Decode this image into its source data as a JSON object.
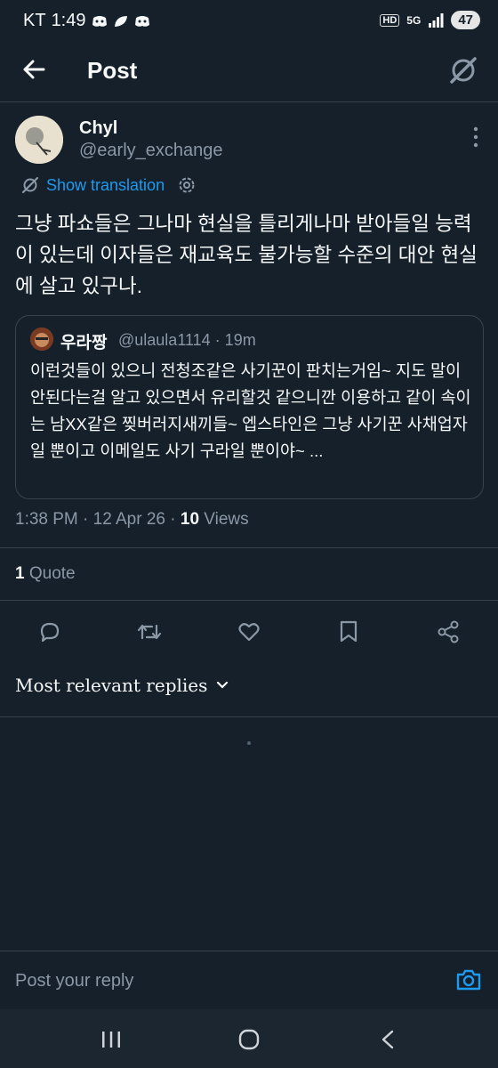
{
  "status_bar": {
    "carrier": "KT",
    "time": "1:49",
    "network_badge": "HD",
    "network_type": "5G",
    "battery": "47"
  },
  "header": {
    "title": "Post"
  },
  "post": {
    "display_name": "Chyl",
    "handle": "@early_exchange",
    "translate_label": "Show translation",
    "text": "그냥 파쇼들은 그나마 현실을 틀리게나마 받아들일 능력이 있는데 이자들은 재교육도 불가능할 수준의 대안 현실에 살고 있구나.",
    "quoted": {
      "display_name": "우라짱",
      "handle_time": "@ulaula1114 · 19m",
      "text": "이런것들이 있으니 전청조같은 사기꾼이 판치는거임~ 지도 말이 안된다는걸 알고 있으면서 유리할것 같으니깐 이용하고 같이 속이는 남XX같은 찢버러지새끼들~ 엡스타인은 그냥 사기꾼 사채업자일 뿐이고 이메일도 사기 구라일 뿐이야~ ..."
    },
    "timestamp": "1:38 PM · 12 Apr 26 · ",
    "views_count": "10",
    "views_label": " Views",
    "quote_count": "1",
    "quote_label": " Quote"
  },
  "replies": {
    "sort_label": "Most relevant replies"
  },
  "reply_bar": {
    "placeholder": "Post your reply"
  },
  "colors": {
    "background": "#15202b",
    "accent": "#1d9bf0",
    "secondary_text": "#8b98a5",
    "border": "#38444d"
  },
  "icons": {
    "back": "arrow-left-icon",
    "grok": "grok-icon",
    "more": "more-vertical-icon",
    "translate": "translate-icon",
    "settings": "gear-icon",
    "reply": "reply-icon",
    "repost": "repost-icon",
    "like": "heart-icon",
    "bookmark": "bookmark-icon",
    "share": "share-icon",
    "camera": "camera-icon"
  }
}
